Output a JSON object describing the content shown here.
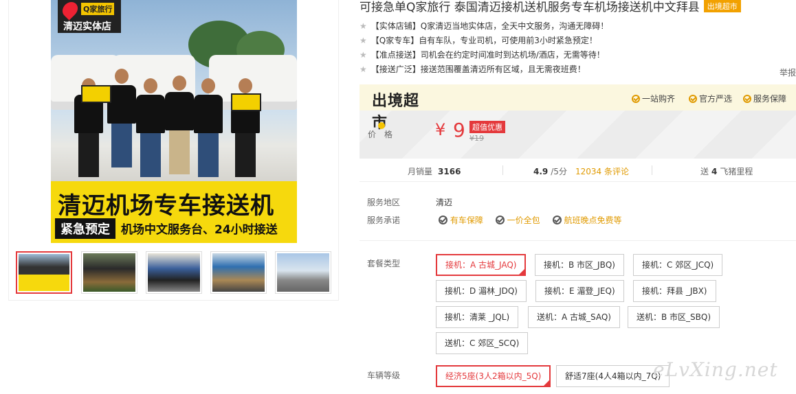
{
  "gallery": {
    "badge_brand": "Q家旅行",
    "badge_store": "清迈实体店",
    "banner_title": "清迈机场专车接送机",
    "banner_tag": "紧急预定",
    "banner_sub": "机场中文服务台、24小时接送",
    "thumbnails": [
      {
        "label": "清迈机场专车接送机"
      },
      {
        "label": ""
      },
      {
        "label": ""
      },
      {
        "label": ""
      },
      {
        "label": ""
      }
    ]
  },
  "product": {
    "title": "可接急单Q家旅行 泰国清迈接机送机服务专车机场接送机中文拜县",
    "title_tag": "出境超市",
    "features": [
      "【实体店铺】Q家清迈当地实体店，全天中文服务，沟通无障碍！",
      "【Q家专车】自有车队，专业司机，可使用前3小时紧急预定！",
      "【准点接送】司机会在约定时间准时到达机场/酒店，无需等待！",
      "【接送广泛】接送范围覆盖清迈所有区域，且无需夜班费！"
    ],
    "report": "举报"
  },
  "market": {
    "logo": "出境超市",
    "assurances": [
      "一站购齐",
      "官方严选",
      "服务保障"
    ]
  },
  "price": {
    "label": "价格",
    "currency": "¥",
    "value": "9",
    "tag": "超值优惠",
    "original": "¥19"
  },
  "stats": {
    "sales_label": "月销量",
    "sales_value": "3166",
    "rating": "4.9",
    "rating_suffix": "/5分",
    "reviews": "12034 条评论",
    "points_prefix": "送",
    "points_value": "4",
    "points_suffix": "飞猪里程"
  },
  "service": {
    "area_label": "服务地区",
    "area_value": "清迈",
    "promise_label": "服务承诺",
    "promises": [
      "有车保障",
      "一价全包",
      "航班晚点免费等"
    ]
  },
  "package": {
    "label": "套餐类型",
    "options": [
      "接机：A 古城_JAQ)",
      "接机：B 市区_JBQ)",
      "接机：C 郊区_JCQ)",
      "接机：D 湄林_JDQ)",
      "接机：E 湄登_JEQ)",
      "接机：拜县 _JBX)",
      "接机：清莱 _JQL)",
      "送机：A 古城_SAQ)",
      "送机：B 市区_SBQ)",
      "送机：C 郊区_SCQ)"
    ],
    "selected": 0
  },
  "vehicle": {
    "label": "车辆等级",
    "options": [
      "经济5座(3人2箱以内_5Q)",
      "舒适7座(4人4箱以内_7Q)"
    ],
    "selected": 0
  },
  "watermark": "eLvXing.net",
  "colors": {
    "accent": "#e4393c",
    "brand_orange": "#e09a00",
    "banner_yellow": "#f6d90d"
  }
}
